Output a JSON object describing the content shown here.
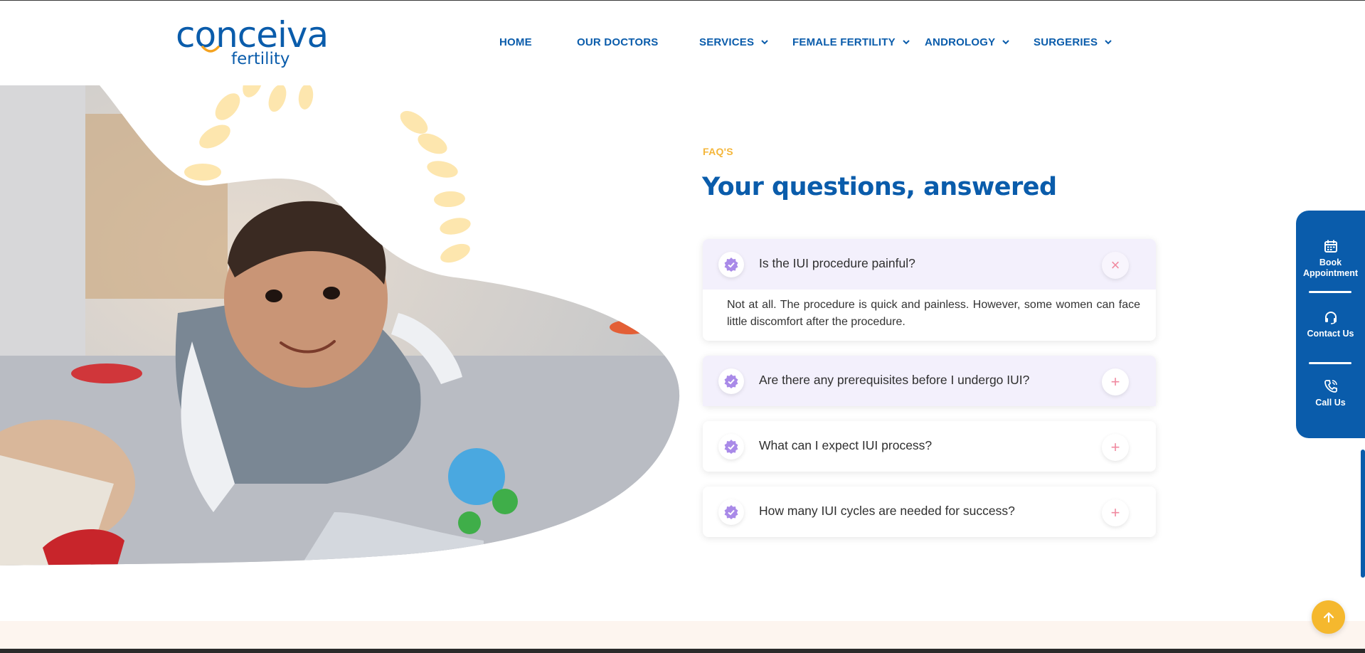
{
  "brand": {
    "name": "conceiva",
    "sub": "fertility"
  },
  "nav": {
    "items": [
      {
        "label": "HOME",
        "dropdown": false
      },
      {
        "label": "OUR DOCTORS",
        "dropdown": false
      },
      {
        "label": "SERVICES",
        "dropdown": true
      },
      {
        "label": "FEMALE FERTILITY",
        "dropdown": true
      },
      {
        "label": "ANDROLOGY",
        "dropdown": true
      },
      {
        "label": "SURGERIES",
        "dropdown": true
      }
    ]
  },
  "hero": {
    "image": "baby-playing-with-toy-photo"
  },
  "faq": {
    "eyebrow": "FAQ'S",
    "title": "Your questions, answered",
    "items": [
      {
        "question": "Is the IUI procedure painful?",
        "answer": "Not at all. The procedure is quick and painless. However, some women can face little discomfort after the procedure.",
        "expanded": true,
        "toggle": "×"
      },
      {
        "question": "Are there any prerequisites before I undergo IUI?",
        "expanded": false,
        "toggle": "+"
      },
      {
        "question": "What can I expect IUI process?",
        "expanded": false,
        "toggle": "+"
      },
      {
        "question": "How many IUI cycles are needed for success?",
        "expanded": false,
        "toggle": "+"
      }
    ]
  },
  "side_widget": {
    "book": "Book Appointment",
    "contact": "Contact Us",
    "call": "Call Us"
  },
  "colors": {
    "brand_blue": "#0a5cab",
    "accent_yellow": "#f4b63a",
    "faq_shade": "#f3f0fc",
    "badge_purple": "#a98ae8",
    "toggle_pink": "#f08aa0"
  },
  "icons": {
    "book": "calendar-icon",
    "contact": "headset-icon",
    "call": "phone-icon",
    "to_top": "arrow-up-icon",
    "faq_badge": "check-badge-icon"
  }
}
